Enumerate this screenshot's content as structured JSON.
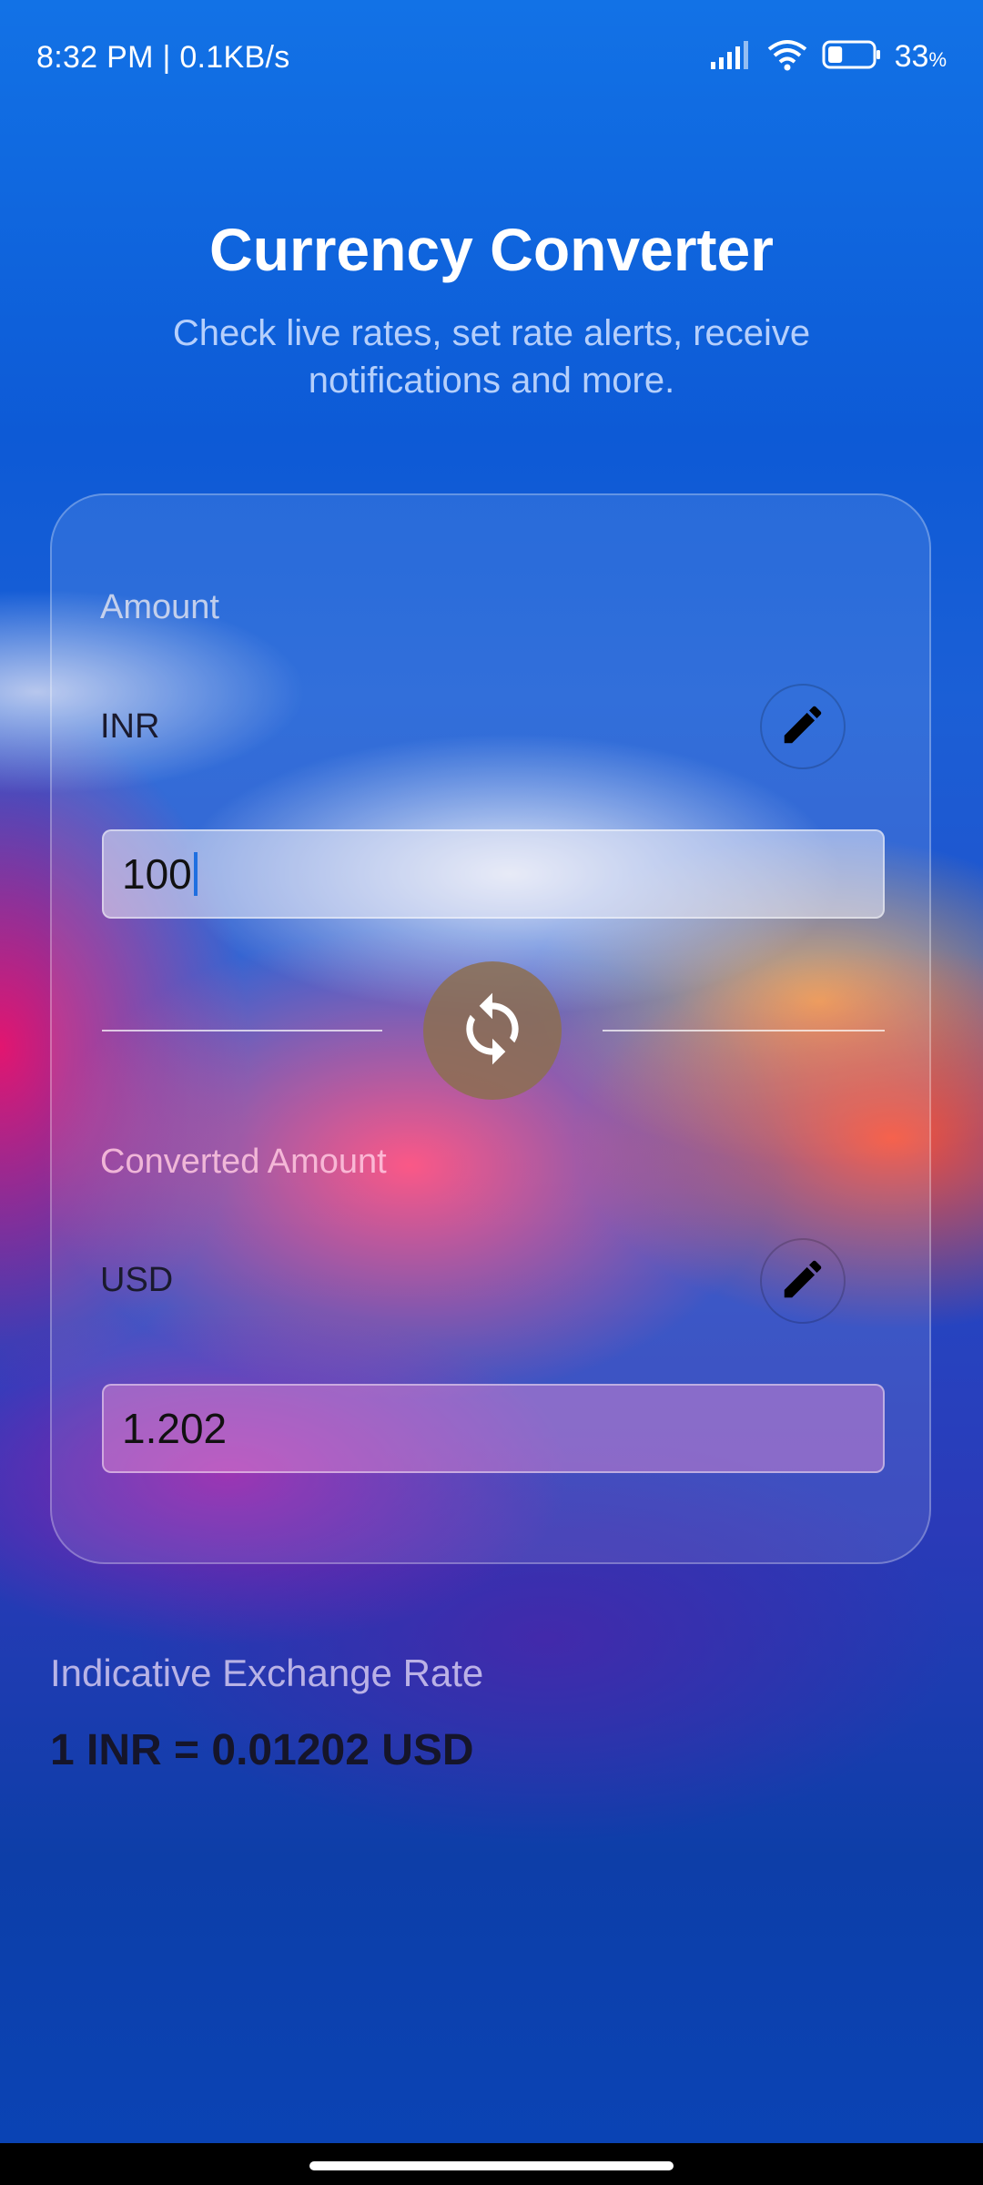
{
  "status_bar": {
    "time_speed": "8:32 PM | 0.1KB/s",
    "battery_value": "33",
    "battery_unit": "%",
    "battery_level": 0.33,
    "icons": [
      "signal-icon",
      "wifi-icon",
      "battery-icon"
    ]
  },
  "header": {
    "title": "Currency Converter",
    "subtitle": "Check live rates, set rate alerts, receive notifications and more."
  },
  "converter": {
    "amount_label": "Amount",
    "from_currency": "INR",
    "from_value": "100",
    "converted_label": "Converted Amount",
    "to_currency": "USD",
    "to_value": "1.202",
    "edit_icon": "pencil-icon",
    "swap_icon": "swap-arrows-icon"
  },
  "rate": {
    "label": "Indicative Exchange Rate",
    "value": "1 INR = 0.01202 USD"
  },
  "colors": {
    "accent": "#1f6fe0",
    "title": "#ffffff",
    "dark_text": "#15152a"
  }
}
